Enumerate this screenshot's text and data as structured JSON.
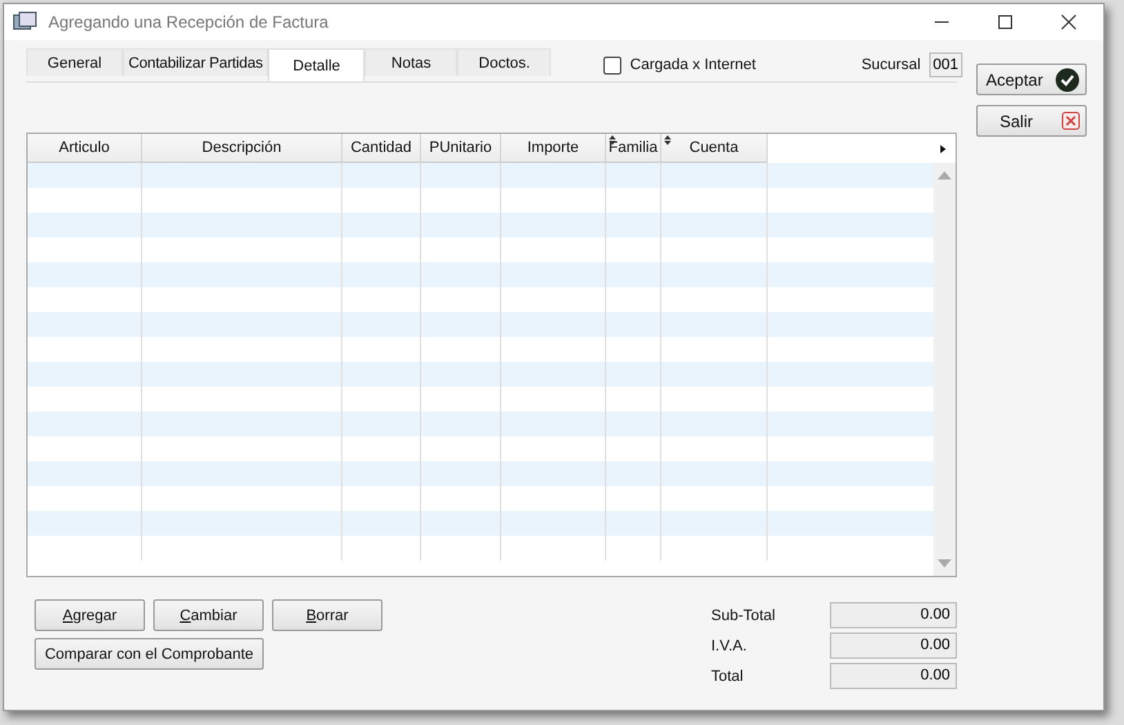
{
  "window": {
    "title": "Agregando una Recepción de Factura"
  },
  "tabs": [
    {
      "label": "General",
      "selected": false
    },
    {
      "label": "Contabilizar Partidas",
      "selected": false
    },
    {
      "label": "Detalle",
      "selected": true
    },
    {
      "label": "Notas",
      "selected": false
    },
    {
      "label": "Doctos.",
      "selected": false
    }
  ],
  "internet": {
    "label": "Cargada x Internet",
    "checked": false
  },
  "sucursal": {
    "label": "Sucursal",
    "value": "001"
  },
  "side_buttons": [
    {
      "label": "Aceptar",
      "kind": "ok"
    },
    {
      "label": "Salir",
      "kind": "exit"
    }
  ],
  "table": {
    "columns": [
      {
        "label": "Articulo",
        "sortable": false
      },
      {
        "label": "Descripción",
        "sortable": false
      },
      {
        "label": "Cantidad",
        "sortable": false
      },
      {
        "label": "PUnitario",
        "sortable": false
      },
      {
        "label": "Importe",
        "sortable": false
      },
      {
        "label": "Familia",
        "sortable": true
      },
      {
        "label": "Cuenta",
        "sortable": true
      }
    ]
  },
  "actions": [
    {
      "label": "Agregar",
      "mnemonic": true
    },
    {
      "label": "Cambiar",
      "mnemonic": true
    },
    {
      "label": "Borrar",
      "mnemonic": true
    }
  ],
  "compare_button": "Comparar con el Comprobante",
  "totals": [
    {
      "label": "Sub-Total",
      "value": "0.00"
    },
    {
      "label": "I.V.A.",
      "value": "0.00"
    },
    {
      "label": "Total",
      "value": "0.00"
    }
  ]
}
